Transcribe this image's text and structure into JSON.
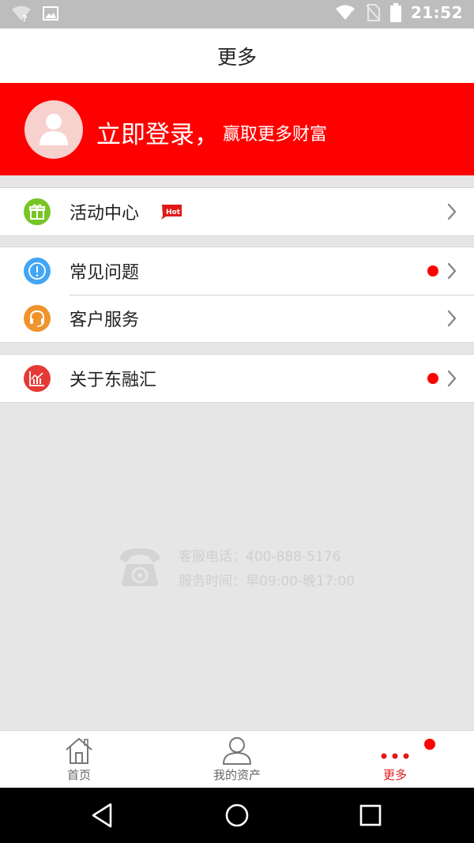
{
  "status_bar": {
    "time": "21:52",
    "icons": [
      "wifi-unknown-icon",
      "image-icon",
      "wifi-icon",
      "no-sim-icon",
      "battery-icon"
    ]
  },
  "header": {
    "title": "更多"
  },
  "login_banner": {
    "main_text": "立即登录，",
    "sub_text": "赢取更多财富"
  },
  "menu": {
    "activity": {
      "label": "活动中心",
      "hot_badge": "Hot",
      "icon": "gift-icon",
      "color": "#77c524"
    },
    "faq": {
      "label": "常见问题",
      "icon": "info-icon",
      "color": "#42a5f5",
      "has_dot": true
    },
    "service": {
      "label": "客户服务",
      "icon": "headset-icon",
      "color": "#f0932b"
    },
    "about": {
      "label": "关于东融汇",
      "icon": "chart-icon",
      "color": "#e53935",
      "has_dot": true
    }
  },
  "contact": {
    "phone": "客服电话：400-888-5176",
    "hours": "服务时间：早09:00-晚17:00"
  },
  "tabbar": {
    "home": "首页",
    "assets": "我的资产",
    "more": "更多"
  },
  "colors": {
    "accent": "#ff0000",
    "active_tab": "#e21818"
  }
}
